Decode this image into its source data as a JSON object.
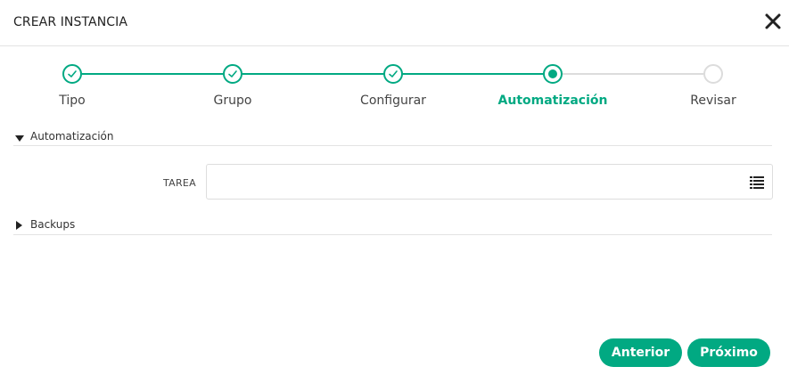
{
  "dialog": {
    "title": "CREAR INSTANCIA",
    "close_icon": "close-icon"
  },
  "stepper": {
    "steps": [
      {
        "label": "Tipo",
        "state": "done"
      },
      {
        "label": "Grupo",
        "state": "done"
      },
      {
        "label": "Configurar",
        "state": "done"
      },
      {
        "label": "Automatización",
        "state": "current"
      },
      {
        "label": "Revisar",
        "state": "pending"
      }
    ]
  },
  "sections": {
    "automation": {
      "label": "Automatización",
      "expanded": true
    },
    "backups": {
      "label": "Backups",
      "expanded": false
    }
  },
  "form": {
    "task_label": "TAREA",
    "task_value": "",
    "task_icon": "list-icon"
  },
  "footer": {
    "previous_label": "Anterior",
    "next_label": "Próximo"
  },
  "colors": {
    "accent": "#01a982",
    "pending": "#dcdcdc"
  }
}
